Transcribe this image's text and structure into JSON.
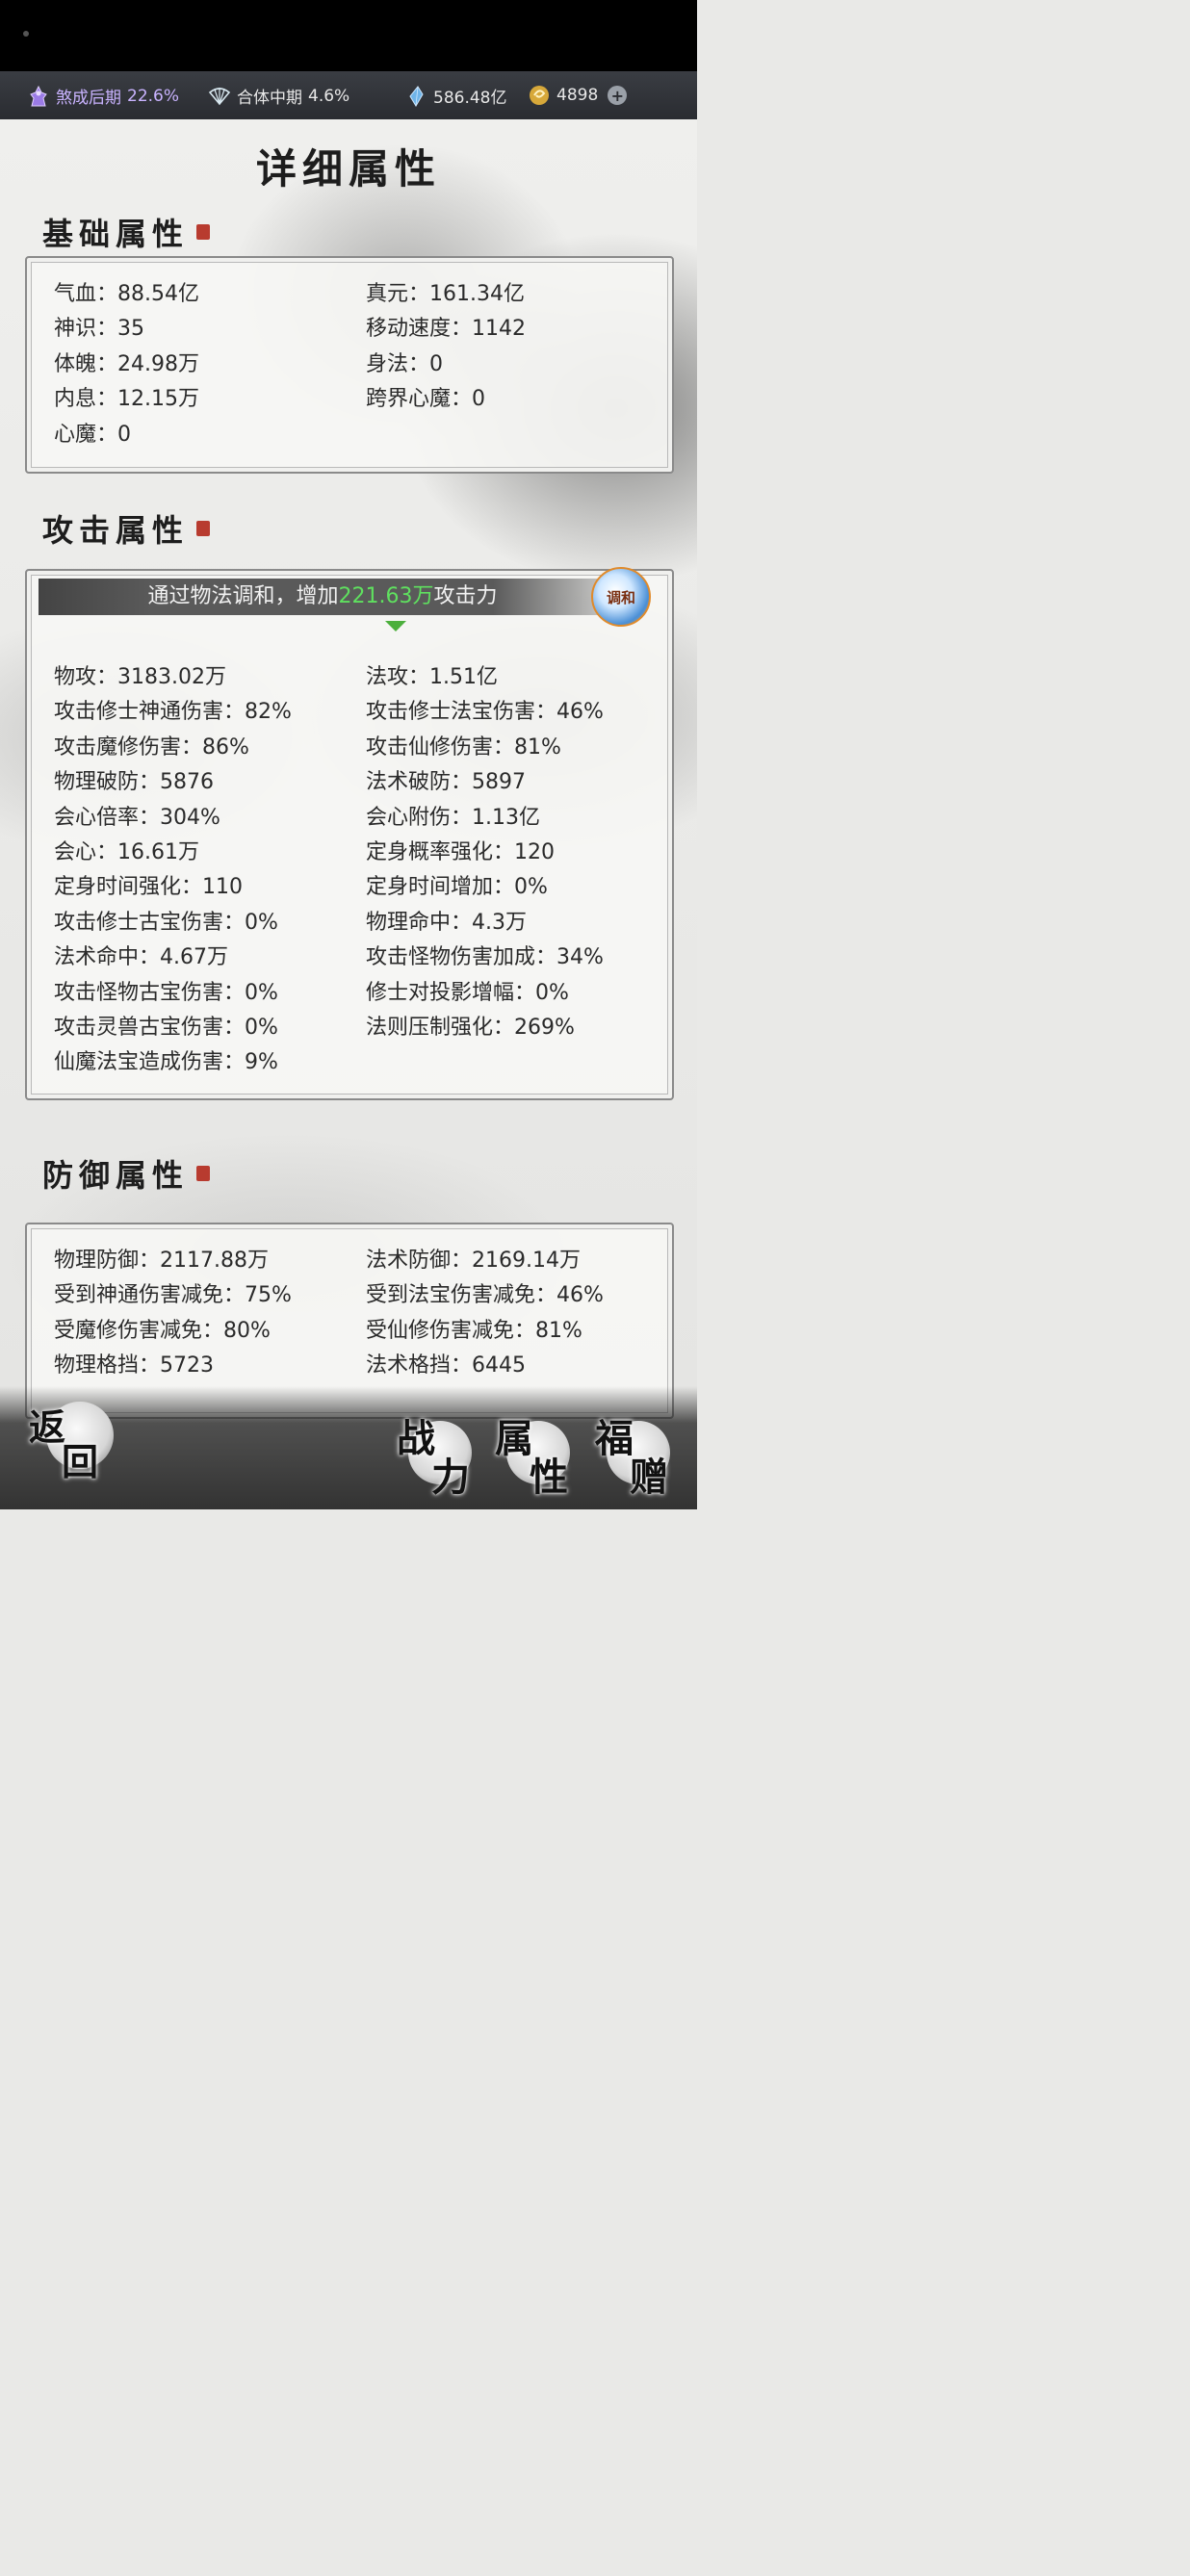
{
  "topbar": {
    "cultivation1": {
      "stage": "煞成后期",
      "percent": "22.6%"
    },
    "cultivation2": {
      "stage": "合体中期",
      "percent": "4.6%"
    },
    "spirit_stones": "586.48亿",
    "currency": "4898"
  },
  "page_title": "详细属性",
  "basic": {
    "heading": "基础属性",
    "rows": [
      {
        "left": "气血：88.54亿",
        "right": "真元：161.34亿"
      },
      {
        "left": "神识：35",
        "right": "移动速度：1142"
      },
      {
        "left": "体魄：24.98万",
        "right": "身法：0"
      },
      {
        "left": "内息：12.15万",
        "right": "跨界心魔：0"
      },
      {
        "left": "心魔：0",
        "right": ""
      }
    ]
  },
  "attack": {
    "heading": "攻击属性",
    "banner_prefix": "通过物法调和，增加",
    "banner_value": "221.63万",
    "banner_suffix": "攻击力",
    "badge_label": "调和",
    "rows": [
      {
        "left": "物攻：3183.02万",
        "right": "法攻：1.51亿"
      },
      {
        "left": "攻击修士神通伤害：82%",
        "right": "攻击修士法宝伤害：46%"
      },
      {
        "left": "攻击魔修伤害：86%",
        "right": "攻击仙修伤害：81%"
      },
      {
        "left": "物理破防：5876",
        "right": "法术破防：5897"
      },
      {
        "left": "会心倍率：304%",
        "right": "会心附伤：1.13亿"
      },
      {
        "left": "会心：16.61万",
        "right": "定身概率强化：120"
      },
      {
        "left": "定身时间强化：110",
        "right": "定身时间增加：0%"
      },
      {
        "left": "攻击修士古宝伤害：0%",
        "right": "物理命中：4.3万"
      },
      {
        "left": "法术命中：4.67万",
        "right": "攻击怪物伤害加成：34%"
      },
      {
        "left": "攻击怪物古宝伤害：0%",
        "right": "修士对投影增幅：0%"
      },
      {
        "left": "攻击灵兽古宝伤害：0%",
        "right": "法则压制强化：269%"
      },
      {
        "left": "仙魔法宝造成伤害：9%",
        "right": ""
      }
    ]
  },
  "defense": {
    "heading": "防御属性",
    "rows": [
      {
        "left": "物理防御：2117.88万",
        "right": "法术防御：2169.14万"
      },
      {
        "left": "受到神通伤害减免：75%",
        "right": "受到法宝伤害减免：46%"
      },
      {
        "left": "受魔修伤害减免：80%",
        "right": "受仙修伤害减免：81%"
      },
      {
        "left": "物理格挡：5723",
        "right": "法术格挡：6445"
      }
    ]
  },
  "nav": {
    "back": [
      "返",
      "回"
    ],
    "power": [
      "战",
      "力"
    ],
    "attributes": [
      "属",
      "性"
    ],
    "gift": [
      "福",
      "赠"
    ]
  }
}
